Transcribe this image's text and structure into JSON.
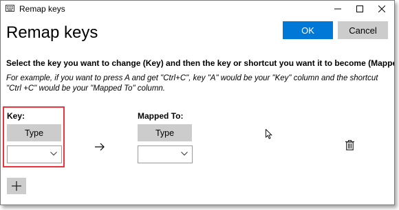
{
  "window": {
    "title": "Remap keys"
  },
  "header": {
    "heading": "Remap keys",
    "ok_label": "OK",
    "cancel_label": "Cancel"
  },
  "instructions": {
    "main": "Select the key you want to change (Key) and then the key or shortcut you want it to become (Mapped To).",
    "example": "For example, if you want to press A and get \"Ctrl+C\", key \"A\" would be your \"Key\" column and the shortcut \"Ctrl +C\" would be your \"Mapped To\" column."
  },
  "key_column": {
    "label": "Key:",
    "type_label": "Type",
    "selected_value": ""
  },
  "mapped_column": {
    "label": "Mapped To:",
    "type_label": "Type",
    "selected_value": ""
  },
  "icons": {
    "app": "keyboard-icon",
    "minimize": "minimize-icon",
    "maximize": "maximize-icon",
    "close": "close-icon",
    "dropdown": "chevron-down-icon",
    "arrow": "arrow-right-icon",
    "delete": "trash-icon",
    "add": "plus-icon",
    "cursor": "mouse-pointer-icon"
  },
  "colors": {
    "accent": "#0078d7",
    "highlight": "#e8343a",
    "button_gray": "#cccccc"
  }
}
